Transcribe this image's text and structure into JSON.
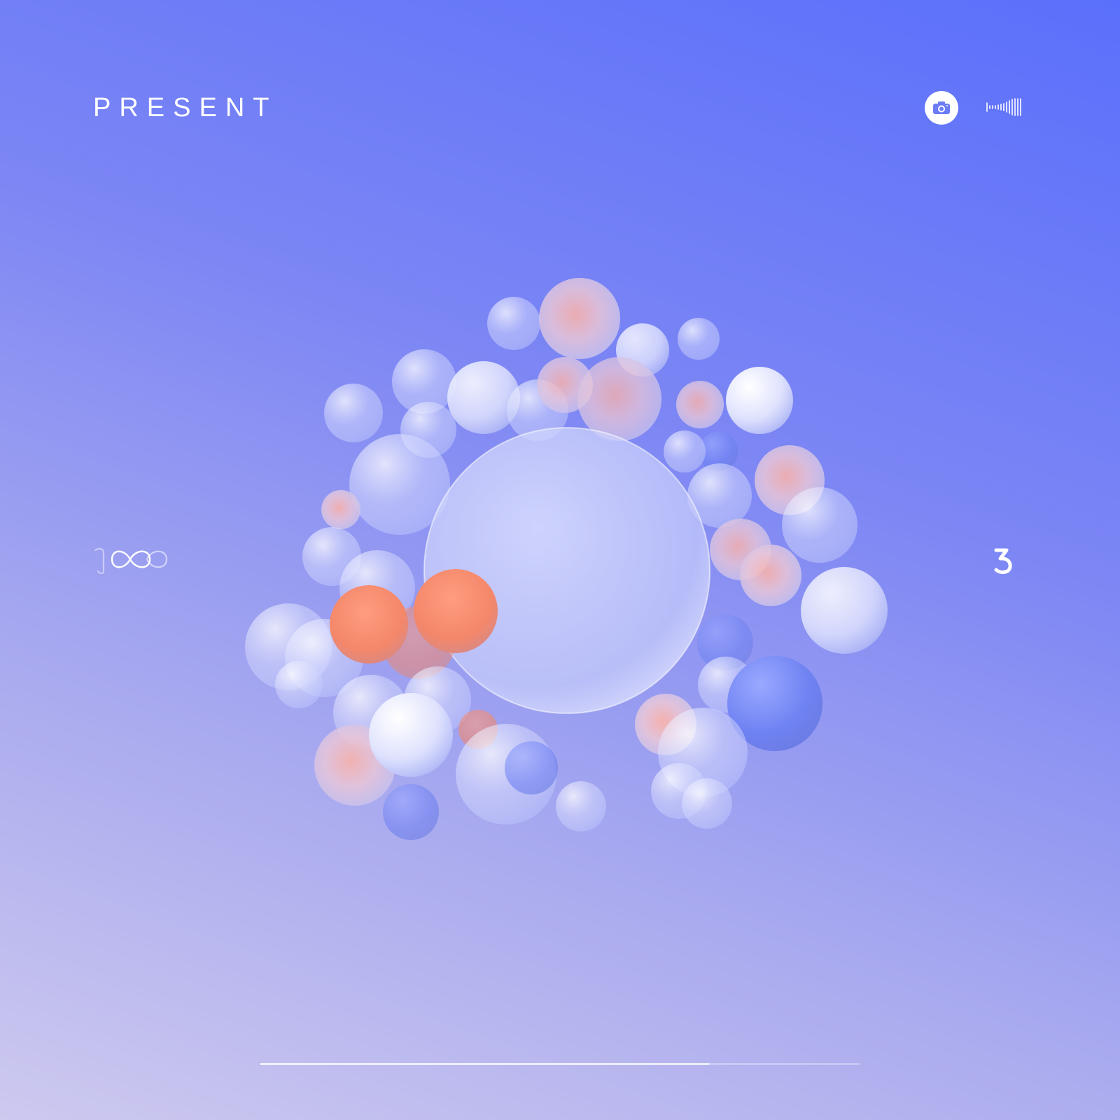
{
  "header": {
    "title": "PRESENT"
  },
  "controls": {
    "camera_icon": "camera-icon",
    "sound_icon": "sound-wave-icon"
  },
  "counters": {
    "left_icon": "one-infinity-icon",
    "right_icon": "number-three-icon"
  },
  "progress": {
    "fraction": 0.75
  },
  "colors": {
    "background_top": "#5a6ffb",
    "background_bottom": "#cdc9ef",
    "accent_orange": "#f4876a",
    "sphere_blue": "#6f82f2",
    "white": "#ffffff"
  }
}
